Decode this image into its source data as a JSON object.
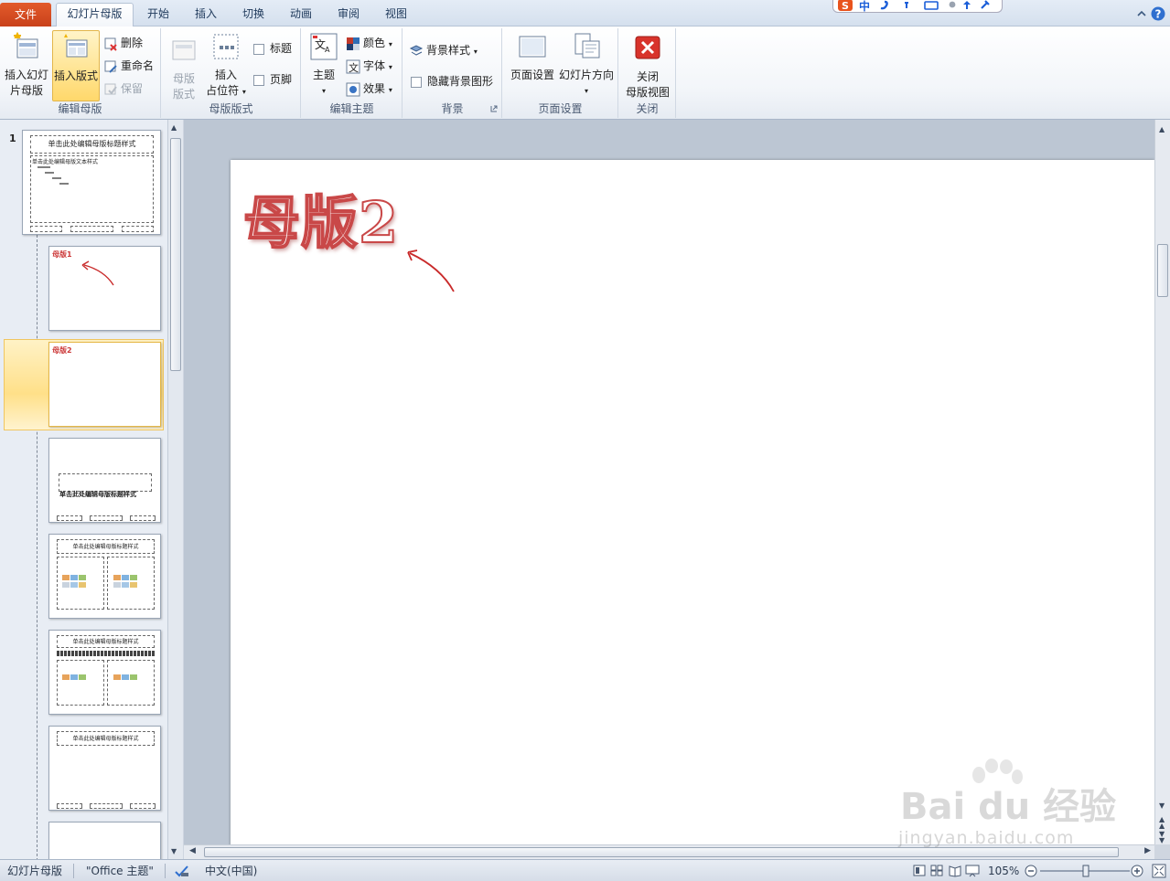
{
  "tabs": [
    {
      "label": "文件"
    },
    {
      "label": "幻灯片母版"
    },
    {
      "label": "开始"
    },
    {
      "label": "插入"
    },
    {
      "label": "切换"
    },
    {
      "label": "动画"
    },
    {
      "label": "审阅"
    },
    {
      "label": "视图"
    }
  ],
  "ime_bar": {
    "mode": "中"
  },
  "ribbon": {
    "groups": {
      "edit_master": "编辑母版",
      "master_layout": "母版版式",
      "edit_theme": "编辑主题",
      "background": "背景",
      "page_setup": "页面设置",
      "close": "关闭"
    },
    "insert_slide_master": {
      "line1": "插入幻灯",
      "line2": "片母版"
    },
    "insert_layout": "插入版式",
    "delete": "删除",
    "rename": "重命名",
    "preserve": "保留",
    "master_layout_btn": {
      "line1": "母版",
      "line2": "版式"
    },
    "insert_placeholder": {
      "line1": "插入",
      "line2": "占位符"
    },
    "title_checkbox": "标题",
    "footer_checkbox": "页脚",
    "theme": "主题",
    "colors": "颜色",
    "fonts": "字体",
    "effects": "效果",
    "background_styles": "背景样式",
    "hide_bg_graphics": "隐藏背景图形",
    "page_setup_btn": "页面设置",
    "slide_orientation": "幻灯片方向",
    "close_master": {
      "line1": "关闭",
      "line2": "母版视图"
    }
  },
  "thumbnails": {
    "master_number": "1",
    "master_title": "单击此处编辑母版标题样式",
    "master_body": "单击此处编辑母版文本样式",
    "layout1_title": "母版1",
    "layout2_title": "母版2",
    "section_header_text": "单击此处编辑母版标题样式",
    "two_content_title": "单击此处编辑母版标题样式"
  },
  "slide": {
    "title": "母版2"
  },
  "watermark": {
    "brand": "Bai du 经验",
    "url": "jingyan.baidu.com"
  },
  "statusbar": {
    "view": "幻灯片母版",
    "theme": "\"Office 主题\"",
    "language": "中文(中国)",
    "zoom": "105%"
  },
  "colors": {
    "accent_red": "#c94848",
    "selection": "#ffe089"
  }
}
